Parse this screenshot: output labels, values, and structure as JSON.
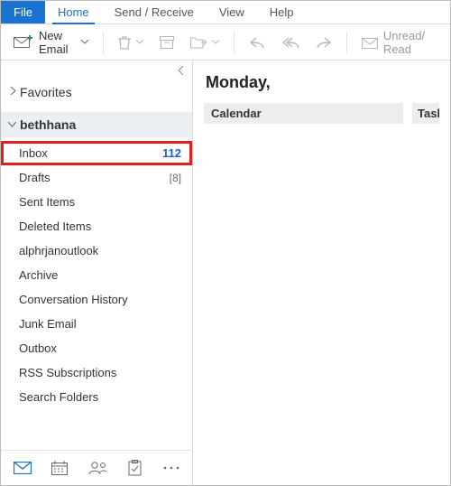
{
  "tabs": {
    "file": "File",
    "home": "Home",
    "send_receive": "Send / Receive",
    "view": "View",
    "help": "Help"
  },
  "toolbar": {
    "new_email": "New Email",
    "unread_read": "Unread/ Read"
  },
  "sidebar": {
    "favorites": "Favorites",
    "account": "bethhana",
    "folders": [
      {
        "label": "Inbox",
        "count": "112",
        "style": "blue",
        "highlighted": true
      },
      {
        "label": "Drafts",
        "count": "[8]",
        "style": "grey"
      },
      {
        "label": "Sent Items"
      },
      {
        "label": "Deleted Items"
      },
      {
        "label": "alphrjanoutlook"
      },
      {
        "label": "Archive"
      },
      {
        "label": "Conversation History"
      },
      {
        "label": "Junk Email"
      },
      {
        "label": "Outbox"
      },
      {
        "label": "RSS Subscriptions"
      },
      {
        "label": "Search Folders"
      }
    ]
  },
  "content": {
    "day": "Monday,",
    "calendar_header": "Calendar",
    "tasks_header": "Tasks"
  }
}
